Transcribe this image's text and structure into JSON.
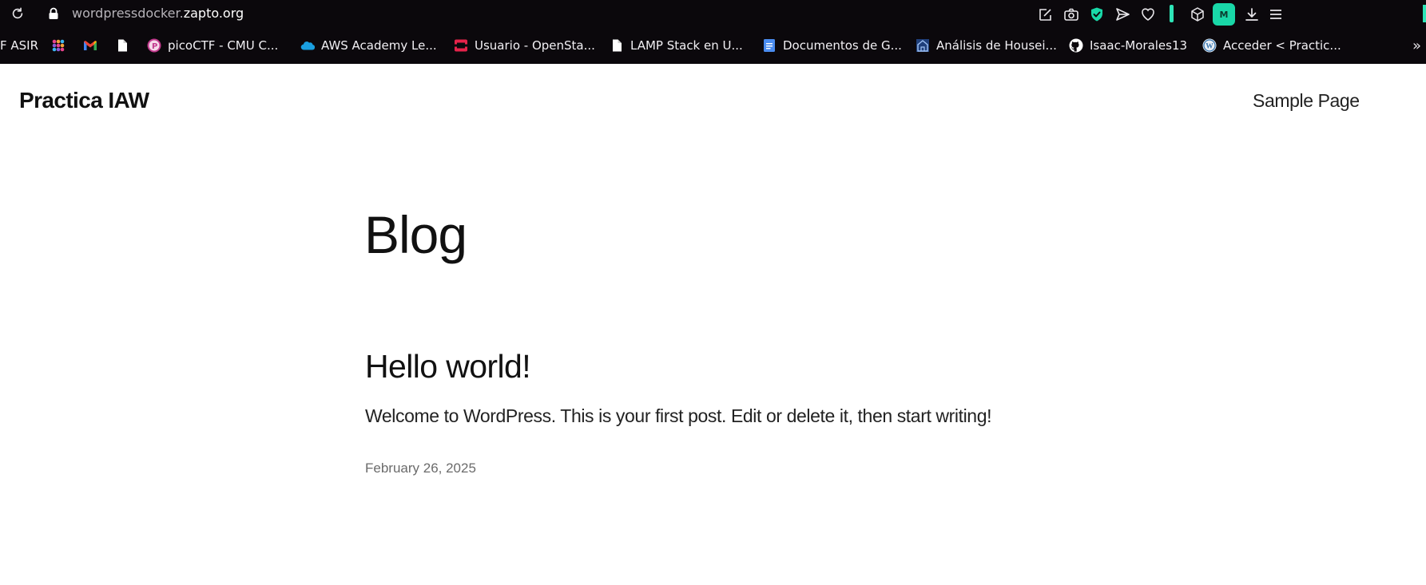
{
  "browser": {
    "url_path": "wordpressdocker.",
    "url_host": "zapto.org",
    "colors": {
      "chrome": "#0b080c",
      "accent": "#19d8a8"
    },
    "toolbar_icons": [
      "edit-page-icon",
      "camera-icon",
      "shield-check-icon",
      "send-icon",
      "heart-icon",
      "status-bar",
      "cube-icon",
      "m-extension-icon",
      "download-icon",
      "menu-icon"
    ],
    "extension_label": "M"
  },
  "bookmarks": [
    {
      "label": "F ASIR",
      "icon": "none"
    },
    {
      "label": "",
      "icon": "slack-like-icon"
    },
    {
      "label": "",
      "icon": "gmail-icon"
    },
    {
      "label": "",
      "icon": "document-icon"
    },
    {
      "label": "picoCTF - CMU C...",
      "icon": "picoctf-icon"
    },
    {
      "label": "AWS Academy Le...",
      "icon": "salesforce-cloud-icon"
    },
    {
      "label": "Usuario - OpenSta...",
      "icon": "openstack-icon"
    },
    {
      "label": "LAMP Stack en U...",
      "icon": "document-icon"
    },
    {
      "label": "Documentos de G...",
      "icon": "google-docs-icon"
    },
    {
      "label": "Análisis de Housei...",
      "icon": "house-icon"
    },
    {
      "label": "Isaac-Morales13",
      "icon": "github-icon"
    },
    {
      "label": "Acceder < Practic...",
      "icon": "wordpress-icon"
    }
  ],
  "bookmarks_more": "»",
  "site": {
    "title": "Practica IAW",
    "nav": [
      "Sample Page"
    ]
  },
  "main": {
    "page_title": "Blog",
    "post": {
      "title": "Hello world!",
      "excerpt": "Welcome to WordPress. This is your first post. Edit or delete it, then start writing!",
      "date": "February 26, 2025"
    }
  }
}
